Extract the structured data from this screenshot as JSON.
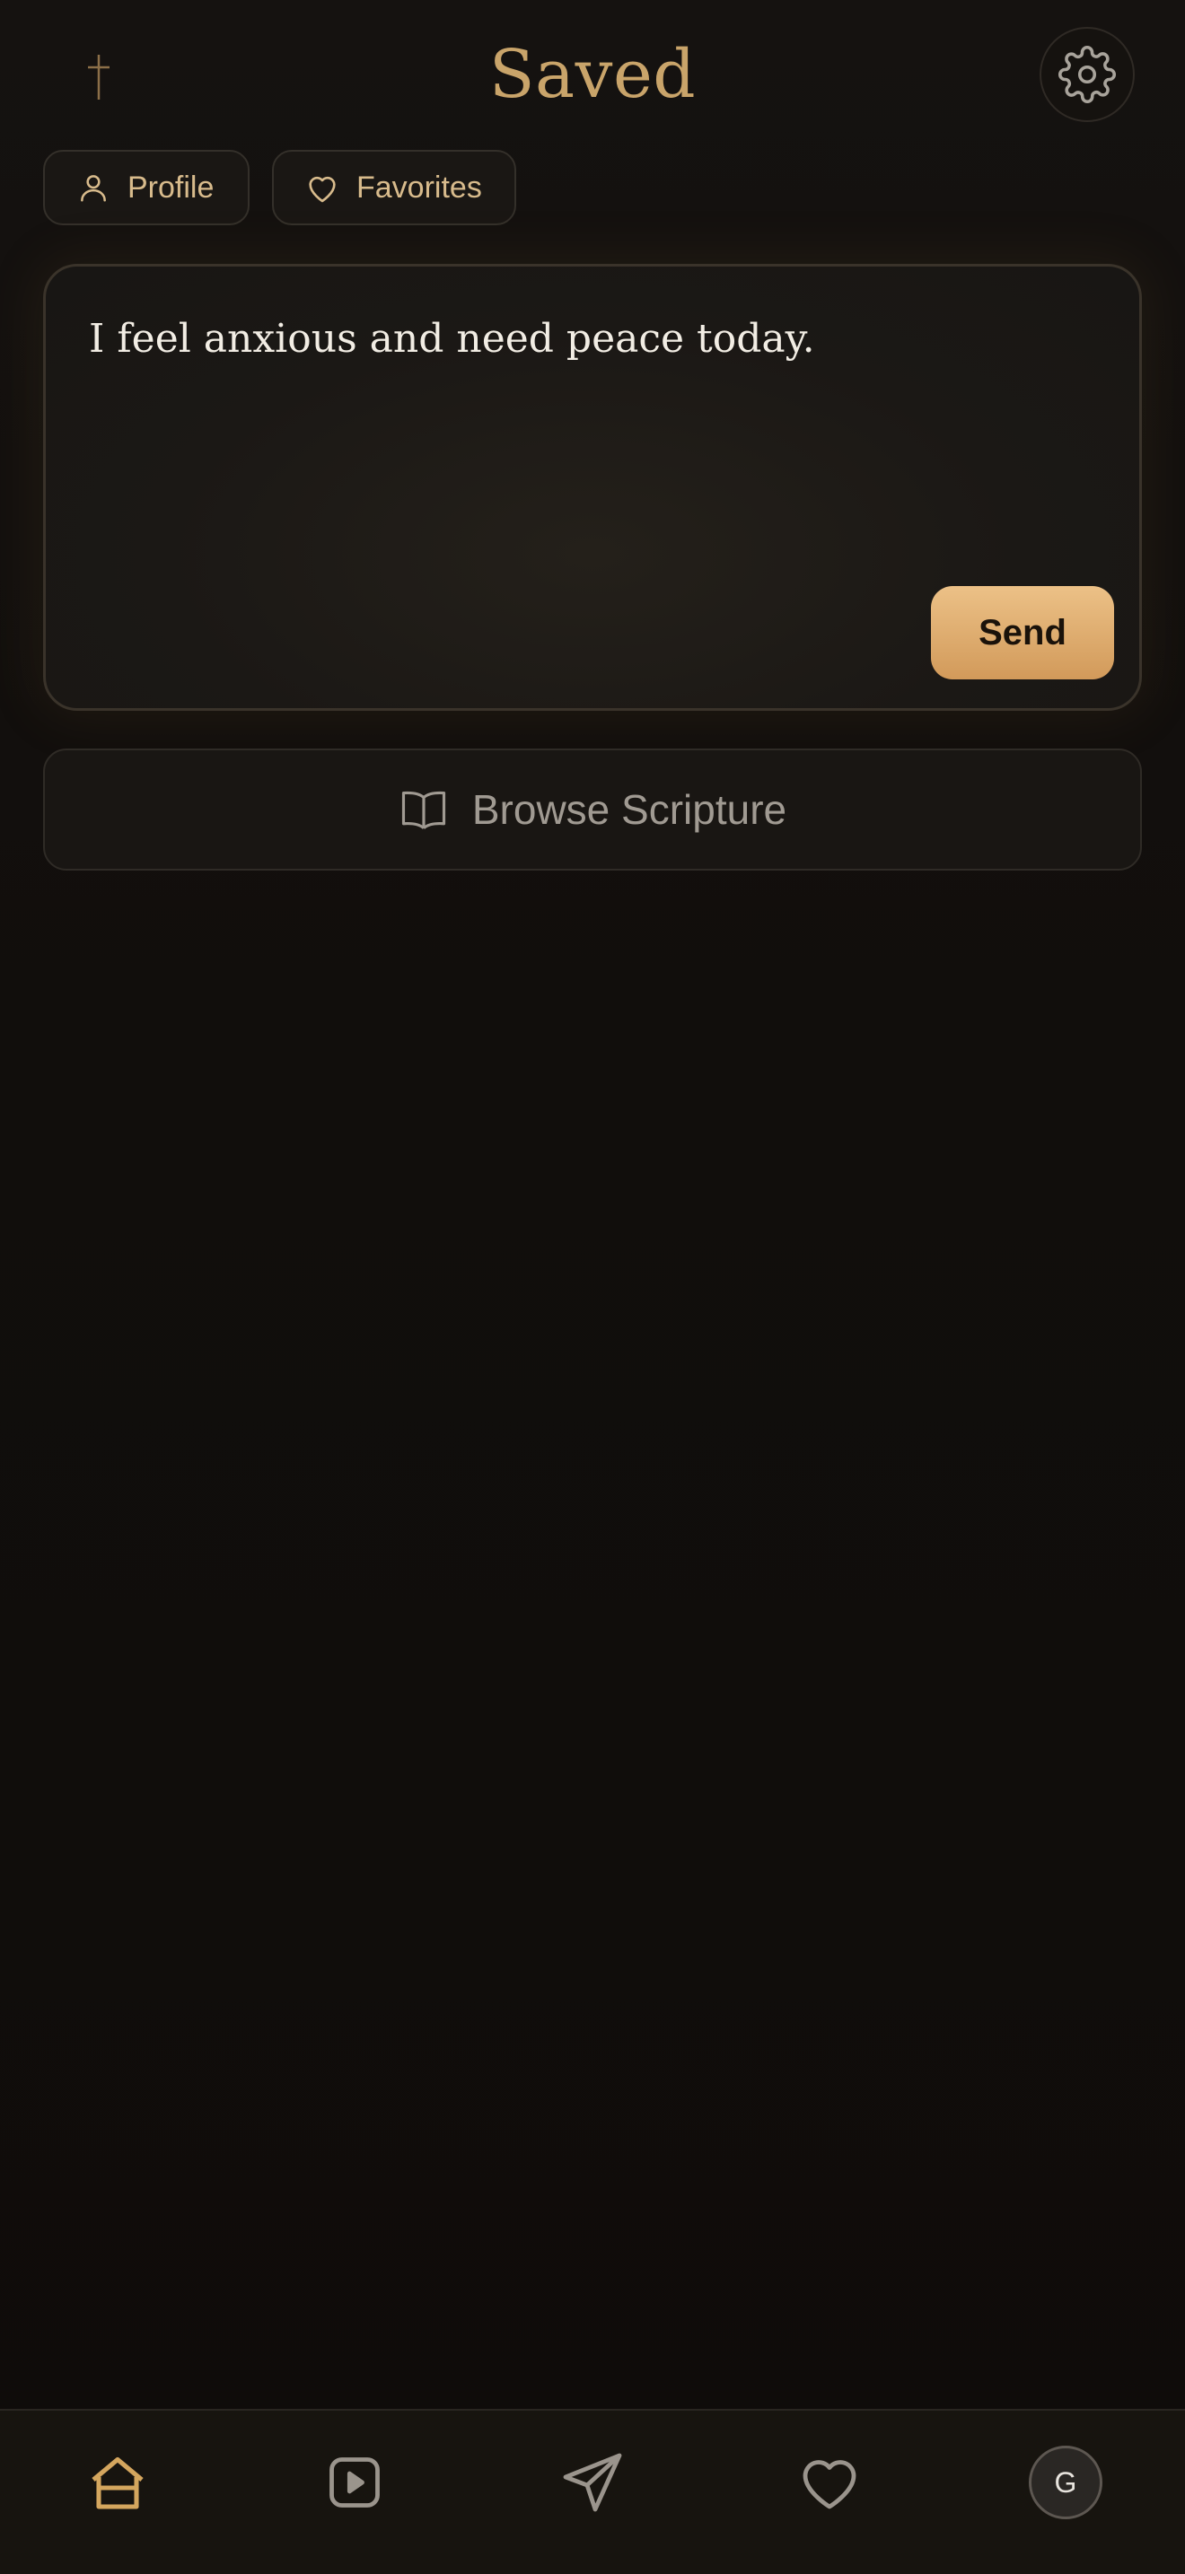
{
  "header": {
    "title": "Saved",
    "left_icon": "cross-icon",
    "right_icon": "gear-icon"
  },
  "chips": [
    {
      "label": "Profile",
      "icon": "person-icon"
    },
    {
      "label": "Favorites",
      "icon": "heart-icon"
    }
  ],
  "composer": {
    "text": "I feel anxious and need peace today.",
    "send_label": "Send"
  },
  "browse": {
    "label": "Browse Scripture",
    "icon": "open-book-icon"
  },
  "bottom_nav": {
    "items": [
      {
        "icon": "home-icon",
        "active": true
      },
      {
        "icon": "play-icon",
        "active": false
      },
      {
        "icon": "paper-plane-icon",
        "active": false
      },
      {
        "icon": "heart-icon",
        "active": false
      },
      {
        "icon": "avatar",
        "active": false
      }
    ],
    "avatar_initial": "G"
  },
  "colors": {
    "accent_gold": "#c9a46a",
    "background": "#100d0b",
    "send_button_top": "#ecc187",
    "send_button_bottom": "#d29a5a",
    "muted_text": "#a09a92"
  }
}
